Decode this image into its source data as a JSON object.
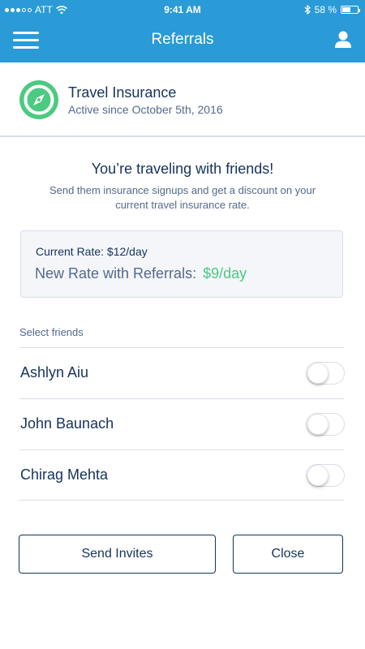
{
  "status_bar": {
    "carrier": "ATT",
    "time": "9:41 AM",
    "battery_percent": "58 %",
    "battery_level": 0.58
  },
  "header": {
    "title": "Referrals",
    "menu_icon": "hamburger-menu-icon",
    "user_icon": "user-icon"
  },
  "product": {
    "name": "Travel Insurance",
    "status": "Active since October 5th, 2016",
    "icon": "compass-icon",
    "icon_color": "#4bca81"
  },
  "hero": {
    "title": "You’re traveling with friends!",
    "subtitle": "Send them insurance signups and get a discount on your current travel insurance rate."
  },
  "rates": {
    "current": "Current Rate: $12/day",
    "new_label": "New Rate with Referrals:",
    "new_value": "$9/day"
  },
  "friends": {
    "label": "Select friends",
    "items": [
      {
        "name": "Ashlyn Aiu",
        "selected": false
      },
      {
        "name": "John Baunach",
        "selected": false
      },
      {
        "name": "Chirag Mehta",
        "selected": false
      }
    ]
  },
  "actions": {
    "send_label": "Send Invites",
    "close_label": "Close"
  },
  "colors": {
    "header": "#2a9bd6",
    "accent_green": "#4bca81",
    "text_primary": "#16325c",
    "text_secondary": "#54698d"
  }
}
